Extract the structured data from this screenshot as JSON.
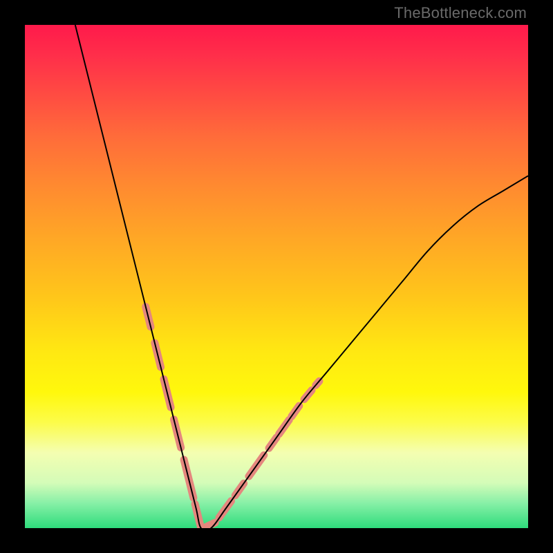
{
  "attribution": "TheBottleneck.com",
  "chart_data": {
    "type": "line",
    "title": "",
    "xlabel": "",
    "ylabel": "",
    "xlim": [
      0,
      100
    ],
    "ylim": [
      0,
      100
    ],
    "grid": false,
    "legend": false,
    "series": [
      {
        "name": "bottleneck-curve",
        "color": "#000000",
        "stroke_width": 2,
        "x": [
          10,
          12,
          15,
          18,
          20,
          22,
          24,
          26,
          28,
          30,
          32,
          34,
          35,
          37,
          40,
          45,
          50,
          55,
          60,
          65,
          70,
          75,
          80,
          85,
          90,
          95,
          100
        ],
        "y": [
          100,
          92,
          80,
          68,
          60,
          52,
          44,
          36,
          28,
          20,
          12,
          4,
          0,
          0,
          4,
          11,
          18,
          25,
          31,
          37,
          43,
          49,
          55,
          60,
          64,
          67,
          70
        ]
      },
      {
        "name": "highlight-segments",
        "color": "#e4877e",
        "stroke_width": 11,
        "linecap": "round",
        "segments": [
          {
            "x": [
              24.0,
              25.0
            ],
            "y": [
              44.0,
              40.0
            ]
          },
          {
            "x": [
              25.8,
              27.0
            ],
            "y": [
              36.8,
              32.0
            ]
          },
          {
            "x": [
              27.6,
              29.0
            ],
            "y": [
              29.6,
              24.0
            ]
          },
          {
            "x": [
              29.6,
              31.0
            ],
            "y": [
              21.6,
              16.0
            ]
          },
          {
            "x": [
              31.6,
              33.5
            ],
            "y": [
              13.6,
              6.0
            ]
          },
          {
            "x": [
              33.8,
              35.0
            ],
            "y": [
              4.8,
              0.0
            ]
          },
          {
            "x": [
              35.5,
              37.8
            ],
            "y": [
              0.0,
              1.1
            ]
          },
          {
            "x": [
              38.6,
              41.0
            ],
            "y": [
              2.1,
              5.4
            ]
          },
          {
            "x": [
              41.8,
              43.5
            ],
            "y": [
              6.5,
              8.9
            ]
          },
          {
            "x": [
              44.5,
              47.5
            ],
            "y": [
              10.3,
              14.5
            ]
          },
          {
            "x": [
              48.5,
              50.0
            ],
            "y": [
              15.9,
              18.0
            ]
          },
          {
            "x": [
              50.5,
              52.5
            ],
            "y": [
              18.7,
              21.5
            ]
          },
          {
            "x": [
              53.0,
              54.5
            ],
            "y": [
              22.2,
              24.3
            ]
          },
          {
            "x": [
              55.5,
              57.0
            ],
            "y": [
              25.6,
              27.4
            ]
          },
          {
            "x": [
              57.8,
              58.5
            ],
            "y": [
              28.4,
              29.2
            ]
          }
        ]
      }
    ],
    "annotations": []
  }
}
